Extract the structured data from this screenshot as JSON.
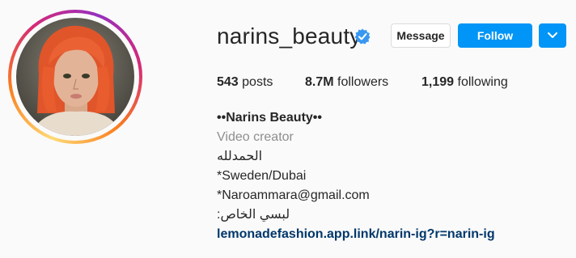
{
  "profile": {
    "username": "narins_beauty",
    "verified_icon": "verified-badge-icon",
    "message_label": "Message",
    "follow_label": "Follow",
    "dropdown_icon": "chevron-down-icon",
    "accent_color": "#0095f6"
  },
  "stats": {
    "posts_count": "543",
    "posts_label": "posts",
    "followers_count": "8.7M",
    "followers_label": "followers",
    "following_count": "1,199",
    "following_label": "following"
  },
  "bio": {
    "name": "••Narins Beauty••",
    "category": "Video creator",
    "line1": "الحمدلله",
    "line2": "*Sweden/Dubai",
    "line3": "*Naroammara@gmail.com",
    "line4": "لبسي الخاص:",
    "link": "lemonadefashion.app.link/narin-ig?r=narin-ig"
  }
}
